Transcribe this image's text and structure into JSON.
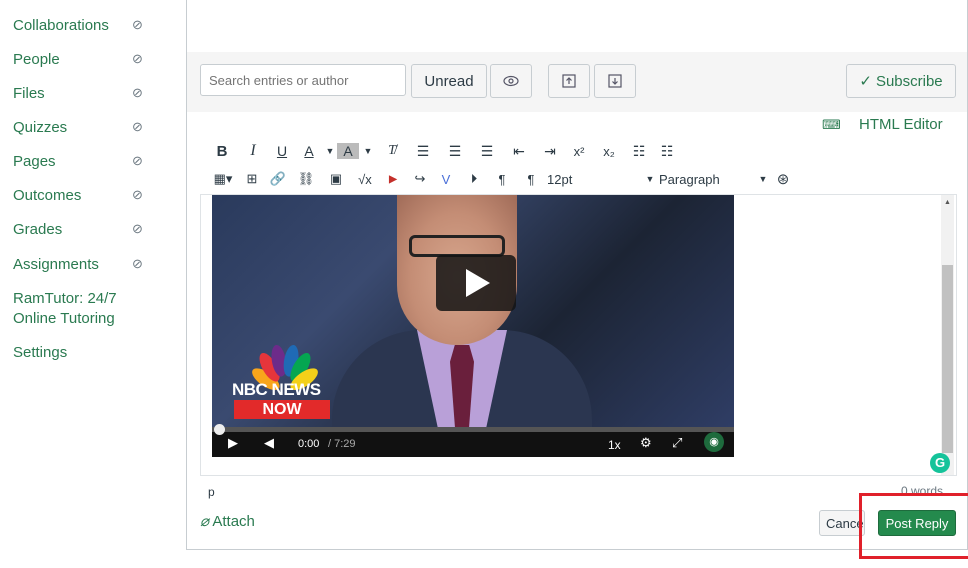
{
  "sidebar": {
    "items": [
      {
        "label": "Collaborations",
        "hidden": true
      },
      {
        "label": "People",
        "hidden": true
      },
      {
        "label": "Files",
        "hidden": true
      },
      {
        "label": "Quizzes",
        "hidden": true
      },
      {
        "label": "Pages",
        "hidden": true
      },
      {
        "label": "Outcomes",
        "hidden": true
      },
      {
        "label": "Grades",
        "hidden": true
      },
      {
        "label": "Assignments",
        "hidden": true
      },
      {
        "label": "RamTutor: 24/7 Online Tutoring",
        "hidden": false
      },
      {
        "label": "Settings",
        "hidden": false
      }
    ]
  },
  "toolbar": {
    "search_placeholder": "Search entries or author",
    "unread_label": "Unread",
    "subscribe_label": "Subscribe"
  },
  "editor": {
    "html_editor_label": "HTML Editor",
    "font_size": "12pt",
    "block_format": "Paragraph"
  },
  "video": {
    "time_current": "0:00",
    "time_total": "/ 7:29",
    "speed": "1x",
    "logo_text": "NBC NEWS",
    "logo_subtext": "NOW"
  },
  "status": {
    "path": "p",
    "word_count": "0 words"
  },
  "actions": {
    "attach_label": "Attach",
    "cancel_label": "Cancel",
    "post_reply_label": "Post Reply"
  },
  "colors": {
    "link_green": "#2a7a50",
    "post_button": "#248a4d",
    "highlight_red": "#e0202a"
  }
}
